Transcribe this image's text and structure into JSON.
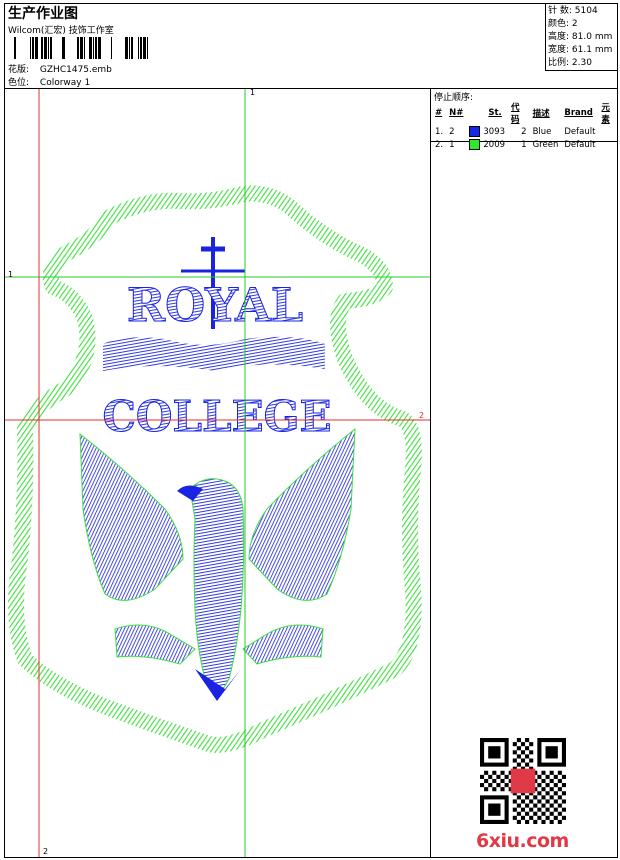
{
  "header": {
    "title": "生产作业图",
    "subtitle": "Wilcom(汇宏) 技饰工作室",
    "design_label": "花版:",
    "design_file": "GZHC1475.emb",
    "color_label": "色位:",
    "colorway": "Colorway 1"
  },
  "stats": [
    {
      "label": "针 数:",
      "value": "5104"
    },
    {
      "label": "颜色:",
      "value": "2"
    },
    {
      "label": "高度:",
      "value": "81.0 mm"
    },
    {
      "label": "宽度:",
      "value": "61.1 mm"
    },
    {
      "label": "比例:",
      "value": "2.30"
    }
  ],
  "stop_sequence": {
    "title": "停止顺序:",
    "columns": [
      "#",
      "N#",
      "St.",
      "代码",
      "描述",
      "Brand",
      "元素"
    ],
    "rows": [
      {
        "idx": "1.",
        "n": "2",
        "code": "3093",
        "st": "2",
        "desc": "Blue",
        "brand": "Default",
        "color": "#1428e6"
      },
      {
        "idx": "2.",
        "n": "1",
        "code": "2009",
        "st": "1",
        "desc": "Green",
        "brand": "Default",
        "color": "#2ee82e"
      }
    ]
  },
  "design": {
    "crown_text": "ROYAL",
    "college_text": "COLLEGE",
    "guide_labels": {
      "v1": "1",
      "h1": "1",
      "h2": "2",
      "v2": "2"
    },
    "thread_colors": {
      "blue": "#1a24e0",
      "green": "#3de03d",
      "guide_green": "#27c927",
      "guide_red": "#e03030"
    }
  },
  "watermark": {
    "text": "6xiu.com"
  }
}
